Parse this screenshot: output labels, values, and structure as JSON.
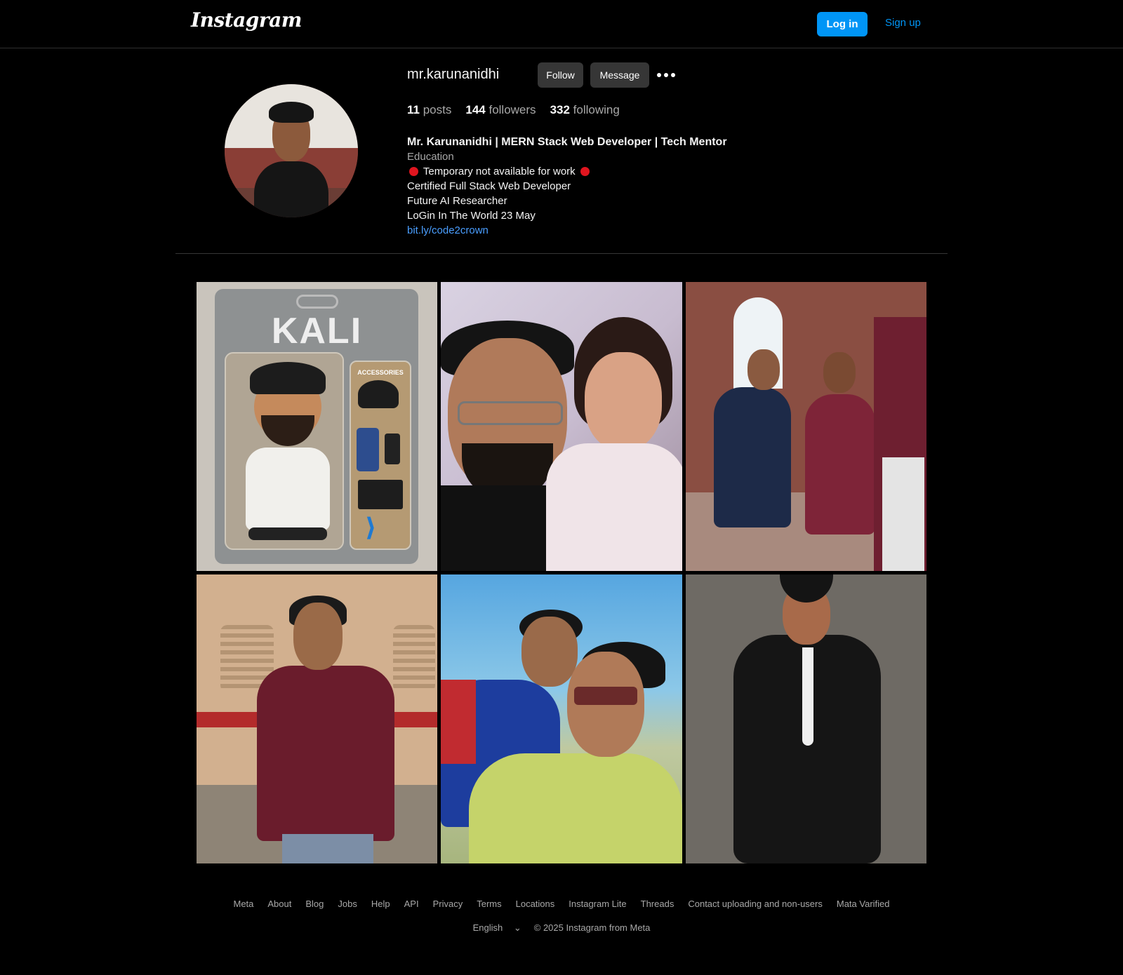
{
  "header": {
    "logo": "Instagram",
    "login_label": "Log in",
    "signup_label": "Sign up"
  },
  "profile": {
    "username": "mr.karunanidhi",
    "follow_label": "Follow",
    "message_label": "Message",
    "more_icon": "more-horizontal-icon",
    "stats": {
      "posts_count": "11",
      "posts_label": "posts",
      "followers_count": "144",
      "followers_label": "followers",
      "following_count": "332",
      "following_label": "following"
    },
    "bio": {
      "full_name": "Mr. Karunanidhi | MERN Stack Web Developer | Tech Mentor",
      "category": "Education",
      "line1": "Temporary not available for work",
      "line2": "Certified Full Stack Web Developer",
      "line3": "Future AI Researcher",
      "line4": "LoGin In The World 23 May",
      "link": "bit.ly/code2crown"
    }
  },
  "posts": {
    "tile1": {
      "package_title": "KALI",
      "accessories_label": "ACCESSORIES"
    }
  },
  "footer": {
    "links": [
      "Meta",
      "About",
      "Blog",
      "Jobs",
      "Help",
      "API",
      "Privacy",
      "Terms",
      "Locations",
      "Instagram Lite",
      "Threads",
      "Contact uploading and non-users",
      "Mata Varified"
    ],
    "language": "English",
    "copyright": "© 2025 Instagram from Meta"
  },
  "colors": {
    "background": "#000000",
    "accent": "#0095f6",
    "button_dark": "#363636",
    "status_dot": "#e0151f",
    "link": "#4a9eff"
  }
}
